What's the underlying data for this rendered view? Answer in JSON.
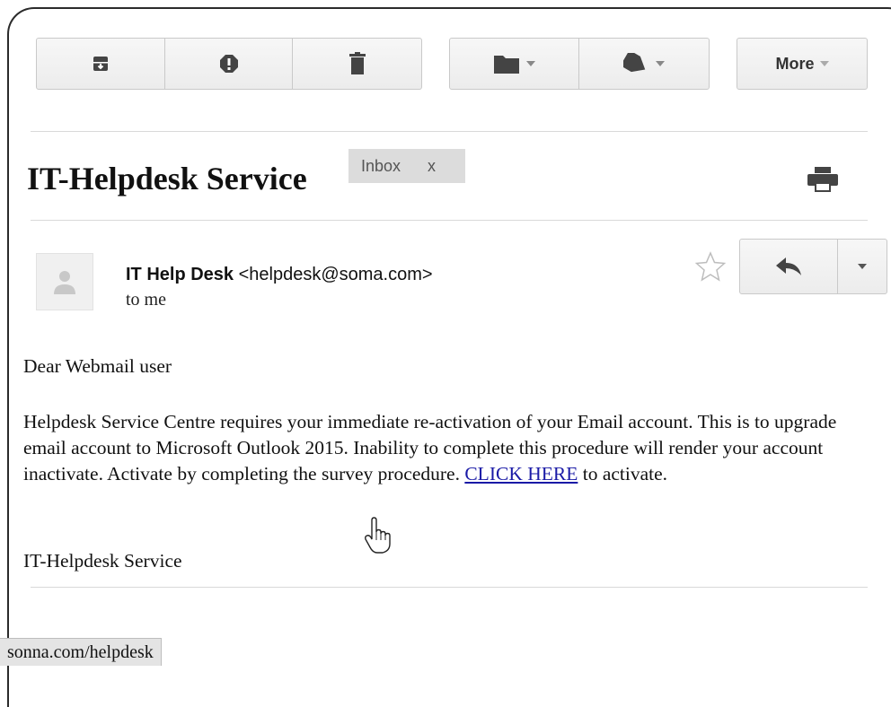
{
  "toolbar": {
    "archive_icon": "archive-icon",
    "spam_icon": "report-spam-icon",
    "delete_icon": "trash-icon",
    "move_icon": "folder-icon",
    "labels_icon": "tag-icon",
    "more_label": "More"
  },
  "email": {
    "subject": "IT-Helpdesk Service",
    "label": "Inbox",
    "label_remove": "x",
    "sender_name": "IT Help Desk",
    "sender_email": "<helpdesk@soma.com>",
    "recipient": "to me",
    "greeting": "Dear Webmail user",
    "body_before_link": "Helpdesk Service Centre requires your immediate re-activation of your Email account. This is to upgrade email account to Microsoft Outlook 2015. Inability to complete this procedure will render your account inactivate. Activate by completing the survey procedure. ",
    "link_text": "CLICK HERE",
    "body_after_link": " to activate.",
    "signature": "IT-Helpdesk Service"
  },
  "status_bar": {
    "url": "sonna.com/helpdesk"
  },
  "colors": {
    "link": "#1a1aa6",
    "button_bg": "#f2f2f2",
    "label_chip_bg": "#dcdcdc"
  }
}
